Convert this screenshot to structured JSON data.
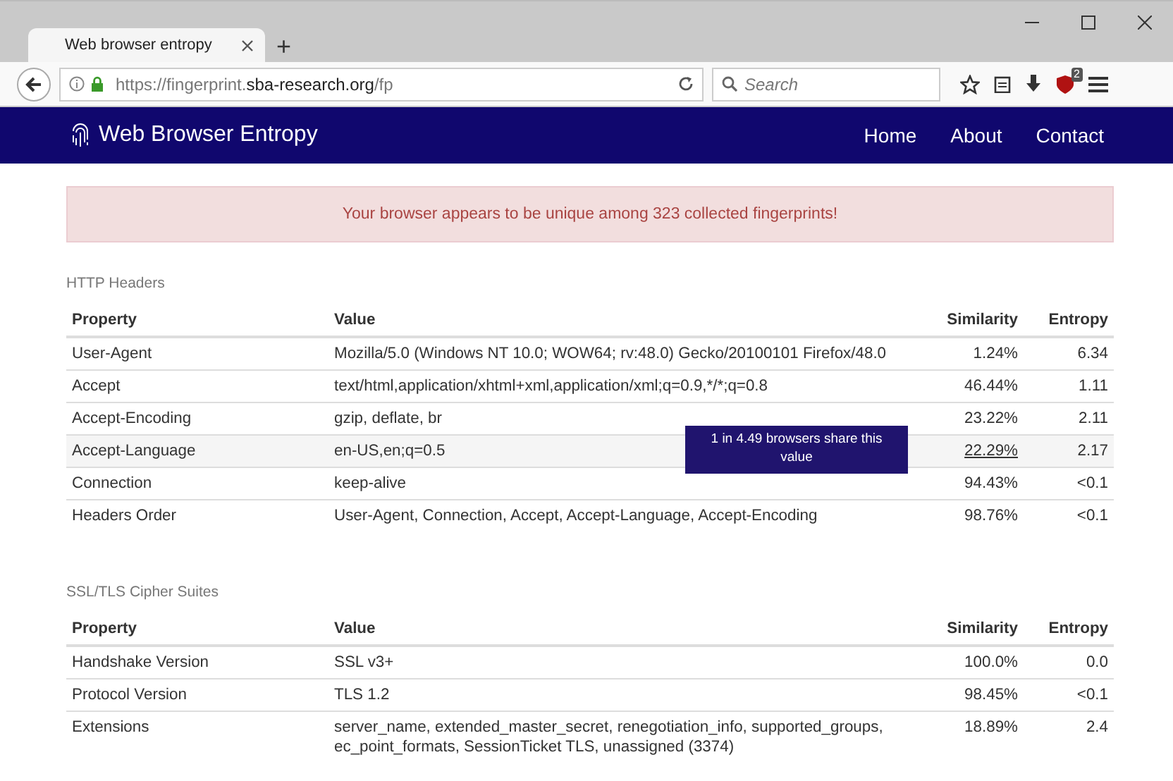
{
  "browser": {
    "tab_title": "Web browser entropy",
    "new_tab": "+",
    "url_prefix": "https://fingerprint.",
    "url_domain": "sba-research.org",
    "url_path": "/fp",
    "search_placeholder": "Search",
    "addon_badge": "2"
  },
  "navbar": {
    "brand": "Web Browser Entropy",
    "links": [
      "Home",
      "About",
      "Contact"
    ]
  },
  "alert": "Your browser appears to be unique among 323 collected fingerprints!",
  "sections": [
    {
      "title": "HTTP Headers",
      "columns": [
        "Property",
        "Value",
        "Similarity",
        "Entropy"
      ],
      "rows": [
        {
          "property": "User-Agent",
          "value": "Mozilla/5.0 (Windows NT 10.0; WOW64; rv:48.0) Gecko/20100101 Firefox/48.0",
          "similarity": "1.24%",
          "entropy": "6.34",
          "hovered": false
        },
        {
          "property": "Accept",
          "value": "text/html,application/xhtml+xml,application/xml;q=0.9,*/*;q=0.8",
          "similarity": "46.44%",
          "entropy": "1.11",
          "hovered": false
        },
        {
          "property": "Accept-Encoding",
          "value": "gzip, deflate, br",
          "similarity": "23.22%",
          "entropy": "2.11",
          "hovered": false
        },
        {
          "property": "Accept-Language",
          "value": "en-US,en;q=0.5",
          "similarity": "22.29%",
          "entropy": "2.17",
          "hovered": true,
          "tooltip": "1 in 4.49 browsers share this value"
        },
        {
          "property": "Connection",
          "value": "keep-alive",
          "similarity": "94.43%",
          "entropy": "<0.1",
          "hovered": false
        },
        {
          "property": "Headers Order",
          "value": "User-Agent, Connection, Accept, Accept-Language, Accept-Encoding",
          "similarity": "98.76%",
          "entropy": "<0.1",
          "hovered": false
        }
      ]
    },
    {
      "title": "SSL/TLS Cipher Suites",
      "columns": [
        "Property",
        "Value",
        "Similarity",
        "Entropy"
      ],
      "rows": [
        {
          "property": "Handshake Version",
          "value": "SSL v3+",
          "similarity": "100.0%",
          "entropy": "0.0",
          "hovered": false
        },
        {
          "property": "Protocol Version",
          "value": "TLS 1.2",
          "similarity": "98.45%",
          "entropy": "<0.1",
          "hovered": false
        },
        {
          "property": "Extensions",
          "value": "server_name, extended_master_secret, renegotiation_info, supported_groups, ec_point_formats, SessionTicket TLS, unassigned (3374)",
          "similarity": "18.89%",
          "entropy": "2.4",
          "hovered": false
        }
      ]
    }
  ]
}
